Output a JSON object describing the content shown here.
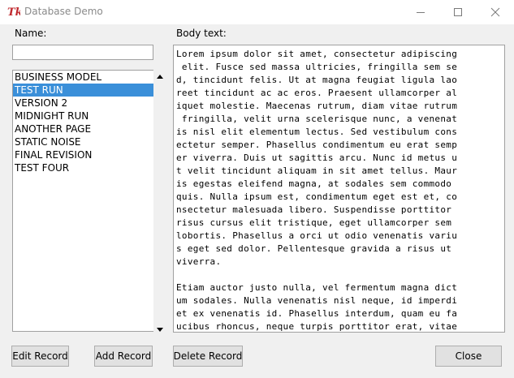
{
  "window": {
    "title": "Database Demo",
    "logo_icon": "tk-feather-icon",
    "minimize_icon": "minimize-icon",
    "maximize_icon": "maximize-icon",
    "close_icon": "close-icon"
  },
  "form": {
    "name_label": "Name:",
    "name_value": "",
    "body_label": "Body text:"
  },
  "records": {
    "items": [
      "BUSINESS MODEL",
      "TEST RUN",
      "VERSION 2",
      "MIDNIGHT RUN",
      "ANOTHER PAGE",
      "STATIC NOISE",
      "FINAL REVISION",
      "TEST FOUR"
    ],
    "selected": "TEST RUN",
    "selected_color": "#3a8fd9"
  },
  "body_text": {
    "lines": [
      "Lorem ipsum dolor sit amet, consectetur adipiscing",
      " elit. Fusce sed massa ultricies, fringilla sem se",
      "d, tincidunt felis. Ut at magna feugiat ligula lao",
      "reet tincidunt ac ac eros. Praesent ullamcorper al",
      "iquet molestie. Maecenas rutrum, diam vitae rutrum",
      " fringilla, velit urna scelerisque nunc, a venenat",
      "is nisl elit elementum lectus. Sed vestibulum cons",
      "ectetur semper. Phasellus condimentum eu erat semp",
      "er viverra. Duis ut sagittis arcu. Nunc id metus u",
      "t velit tincidunt aliquam in sit amet tellus. Maur",
      "is egestas eleifend magna, at sodales sem commodo ",
      "quis. Nulla ipsum est, condimentum eget est et, co",
      "nsectetur malesuada libero. Suspendisse porttitor ",
      "risus cursus elit tristique, eget ullamcorper sem ",
      "lobortis. Phasellus a orci ut odio venenatis variu",
      "s eget sed dolor. Pellentesque gravida a risus ut ",
      "viverra.",
      "",
      "Etiam auctor justo nulla, vel fermentum magna dict",
      "um sodales. Nulla venenatis nisl neque, id imperdi",
      "et ex venenatis id. Phasellus interdum, quam eu fa",
      "ucibus rhoncus, neque turpis porttitor erat, vitae"
    ]
  },
  "buttons": {
    "edit": "Edit Record",
    "add": "Add Record",
    "delete": "Delete Record",
    "close": "Close"
  }
}
